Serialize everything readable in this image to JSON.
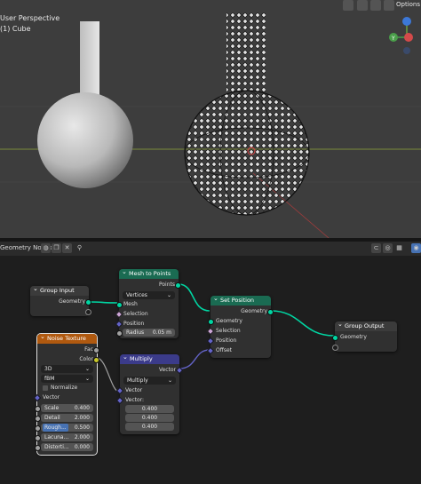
{
  "viewport": {
    "title": "User Perspective",
    "object_name": "(1) Cube",
    "options_label": "Options",
    "gizmo": {
      "x": "X",
      "y": "Y",
      "z": "Z"
    }
  },
  "node_editor": {
    "header_label": "Geometry Nodes",
    "nodes": {
      "group_input": {
        "title": "Group Input",
        "outputs": [
          "Geometry"
        ]
      },
      "mesh_to_points": {
        "title": "Mesh to Points",
        "outputs": [
          "Points"
        ],
        "mode": "Vertices",
        "inputs": [
          "Mesh",
          "Selection",
          "Position"
        ],
        "radius_label": "Radius",
        "radius_value": "0.05 m"
      },
      "set_position": {
        "title": "Set Position",
        "outputs": [
          "Geometry"
        ],
        "inputs": [
          "Geometry",
          "Selection",
          "Position",
          "Offset"
        ]
      },
      "group_output": {
        "title": "Group Output",
        "inputs": [
          "Geometry"
        ]
      },
      "noise_texture": {
        "title": "Noise Texture",
        "outputs": [
          "Fac",
          "Color"
        ],
        "dim": "3D",
        "type": "fBM",
        "normalize_label": "Normalize",
        "vector_label": "Vector",
        "fields": [
          {
            "label": "Scale",
            "value": "0.400"
          },
          {
            "label": "Detail",
            "value": "2.000"
          },
          {
            "label": "Rough...",
            "value": "0.500"
          },
          {
            "label": "Lacuna...",
            "value": "2.000"
          },
          {
            "label": "Distorti...",
            "value": "0.000"
          }
        ]
      },
      "multiply": {
        "title": "Multiply",
        "outputs": [
          "Vector"
        ],
        "operation": "Multiply",
        "inputs": [
          "Vector",
          "Vector:"
        ],
        "values": [
          "0.400",
          "0.400",
          "0.400"
        ]
      }
    }
  },
  "colors": {
    "geometry": "#00d6a3",
    "vector": "#6363c7",
    "float": "#a1a1a1",
    "color": "#c7c729",
    "mesh_to_points_header": "#1a6b52",
    "set_position_header": "#1a6b52",
    "noise_header": "#b0590f",
    "multiply_header": "#3b3b8a"
  }
}
